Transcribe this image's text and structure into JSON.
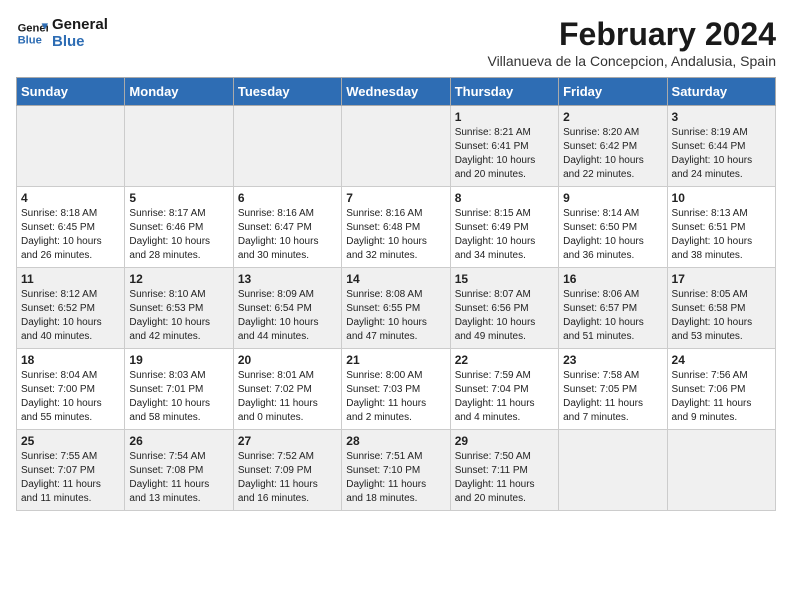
{
  "logo": {
    "line1": "General",
    "line2": "Blue"
  },
  "title": "February 2024",
  "subtitle": "Villanueva de la Concepcion, Andalusia, Spain",
  "days_of_week": [
    "Sunday",
    "Monday",
    "Tuesday",
    "Wednesday",
    "Thursday",
    "Friday",
    "Saturday"
  ],
  "weeks": [
    [
      {
        "day": "",
        "info": ""
      },
      {
        "day": "",
        "info": ""
      },
      {
        "day": "",
        "info": ""
      },
      {
        "day": "",
        "info": ""
      },
      {
        "day": "1",
        "info": "Sunrise: 8:21 AM\nSunset: 6:41 PM\nDaylight: 10 hours\nand 20 minutes."
      },
      {
        "day": "2",
        "info": "Sunrise: 8:20 AM\nSunset: 6:42 PM\nDaylight: 10 hours\nand 22 minutes."
      },
      {
        "day": "3",
        "info": "Sunrise: 8:19 AM\nSunset: 6:44 PM\nDaylight: 10 hours\nand 24 minutes."
      }
    ],
    [
      {
        "day": "4",
        "info": "Sunrise: 8:18 AM\nSunset: 6:45 PM\nDaylight: 10 hours\nand 26 minutes."
      },
      {
        "day": "5",
        "info": "Sunrise: 8:17 AM\nSunset: 6:46 PM\nDaylight: 10 hours\nand 28 minutes."
      },
      {
        "day": "6",
        "info": "Sunrise: 8:16 AM\nSunset: 6:47 PM\nDaylight: 10 hours\nand 30 minutes."
      },
      {
        "day": "7",
        "info": "Sunrise: 8:16 AM\nSunset: 6:48 PM\nDaylight: 10 hours\nand 32 minutes."
      },
      {
        "day": "8",
        "info": "Sunrise: 8:15 AM\nSunset: 6:49 PM\nDaylight: 10 hours\nand 34 minutes."
      },
      {
        "day": "9",
        "info": "Sunrise: 8:14 AM\nSunset: 6:50 PM\nDaylight: 10 hours\nand 36 minutes."
      },
      {
        "day": "10",
        "info": "Sunrise: 8:13 AM\nSunset: 6:51 PM\nDaylight: 10 hours\nand 38 minutes."
      }
    ],
    [
      {
        "day": "11",
        "info": "Sunrise: 8:12 AM\nSunset: 6:52 PM\nDaylight: 10 hours\nand 40 minutes."
      },
      {
        "day": "12",
        "info": "Sunrise: 8:10 AM\nSunset: 6:53 PM\nDaylight: 10 hours\nand 42 minutes."
      },
      {
        "day": "13",
        "info": "Sunrise: 8:09 AM\nSunset: 6:54 PM\nDaylight: 10 hours\nand 44 minutes."
      },
      {
        "day": "14",
        "info": "Sunrise: 8:08 AM\nSunset: 6:55 PM\nDaylight: 10 hours\nand 47 minutes."
      },
      {
        "day": "15",
        "info": "Sunrise: 8:07 AM\nSunset: 6:56 PM\nDaylight: 10 hours\nand 49 minutes."
      },
      {
        "day": "16",
        "info": "Sunrise: 8:06 AM\nSunset: 6:57 PM\nDaylight: 10 hours\nand 51 minutes."
      },
      {
        "day": "17",
        "info": "Sunrise: 8:05 AM\nSunset: 6:58 PM\nDaylight: 10 hours\nand 53 minutes."
      }
    ],
    [
      {
        "day": "18",
        "info": "Sunrise: 8:04 AM\nSunset: 7:00 PM\nDaylight: 10 hours\nand 55 minutes."
      },
      {
        "day": "19",
        "info": "Sunrise: 8:03 AM\nSunset: 7:01 PM\nDaylight: 10 hours\nand 58 minutes."
      },
      {
        "day": "20",
        "info": "Sunrise: 8:01 AM\nSunset: 7:02 PM\nDaylight: 11 hours\nand 0 minutes."
      },
      {
        "day": "21",
        "info": "Sunrise: 8:00 AM\nSunset: 7:03 PM\nDaylight: 11 hours\nand 2 minutes."
      },
      {
        "day": "22",
        "info": "Sunrise: 7:59 AM\nSunset: 7:04 PM\nDaylight: 11 hours\nand 4 minutes."
      },
      {
        "day": "23",
        "info": "Sunrise: 7:58 AM\nSunset: 7:05 PM\nDaylight: 11 hours\nand 7 minutes."
      },
      {
        "day": "24",
        "info": "Sunrise: 7:56 AM\nSunset: 7:06 PM\nDaylight: 11 hours\nand 9 minutes."
      }
    ],
    [
      {
        "day": "25",
        "info": "Sunrise: 7:55 AM\nSunset: 7:07 PM\nDaylight: 11 hours\nand 11 minutes."
      },
      {
        "day": "26",
        "info": "Sunrise: 7:54 AM\nSunset: 7:08 PM\nDaylight: 11 hours\nand 13 minutes."
      },
      {
        "day": "27",
        "info": "Sunrise: 7:52 AM\nSunset: 7:09 PM\nDaylight: 11 hours\nand 16 minutes."
      },
      {
        "day": "28",
        "info": "Sunrise: 7:51 AM\nSunset: 7:10 PM\nDaylight: 11 hours\nand 18 minutes."
      },
      {
        "day": "29",
        "info": "Sunrise: 7:50 AM\nSunset: 7:11 PM\nDaylight: 11 hours\nand 20 minutes."
      },
      {
        "day": "",
        "info": ""
      },
      {
        "day": "",
        "info": ""
      }
    ]
  ],
  "gray_weeks": [
    0,
    2,
    4
  ]
}
